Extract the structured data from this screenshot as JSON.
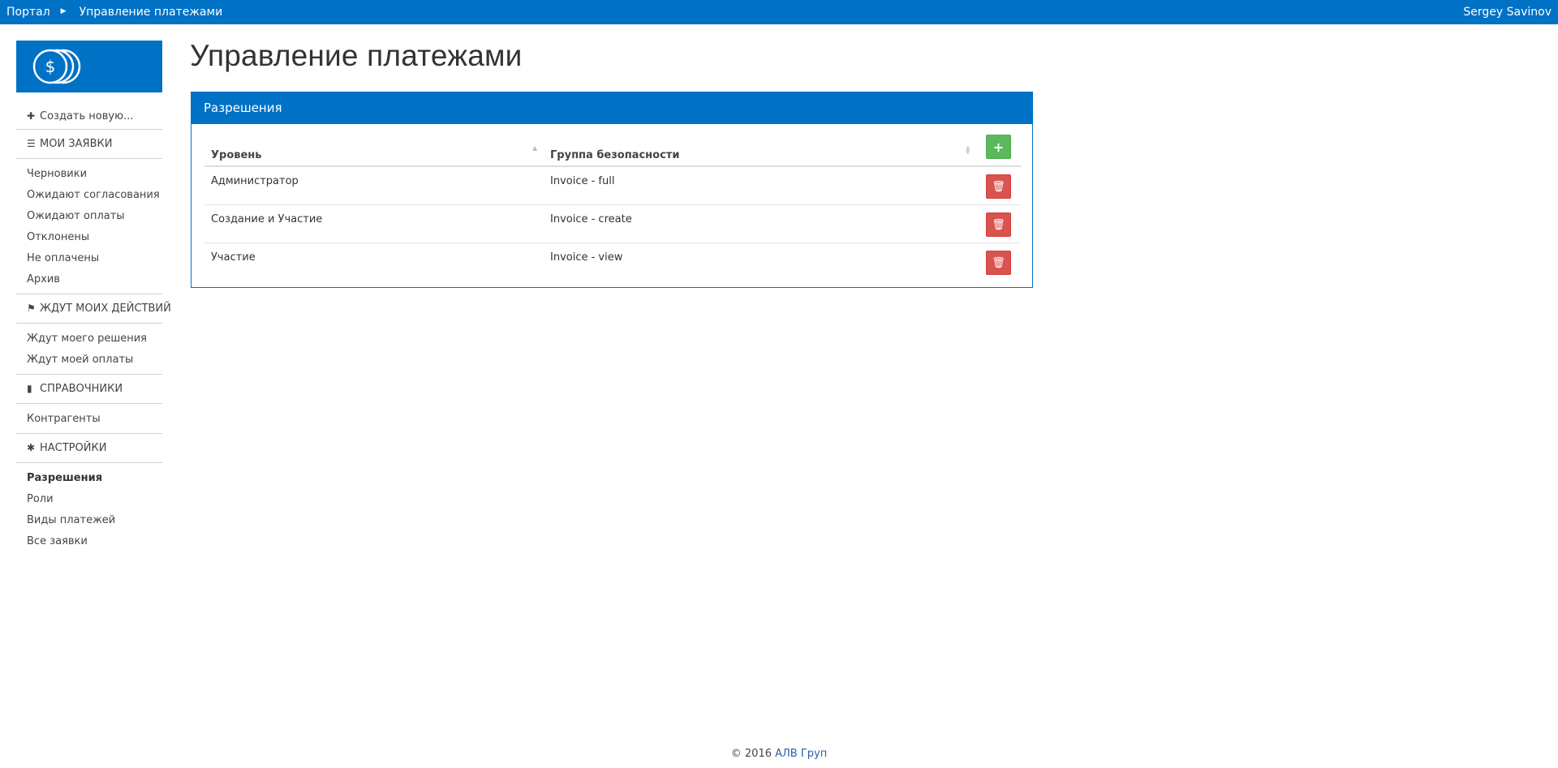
{
  "topbar": {
    "breadcrumb": [
      "Портал",
      "Управление платежами"
    ],
    "user_name": "Sergey Savinov"
  },
  "sidebar": {
    "create_label": "Создать новую...",
    "sections": [
      {
        "title": "МОИ ЗАЯВКИ",
        "icon": "list-icon",
        "items": [
          "Черновики",
          "Ожидают согласования",
          "Ожидают оплаты",
          "Отклонены",
          "Не оплачены",
          "Архив"
        ]
      },
      {
        "title": "ЖДУТ МОИХ ДЕЙСТВИЙ",
        "icon": "flag-icon",
        "items": [
          "Ждут моего решения",
          "Ждут моей оплаты"
        ]
      },
      {
        "title": "СПРАВОЧНИКИ",
        "icon": "book-icon",
        "items": [
          "Контрагенты"
        ]
      },
      {
        "title": "НАСТРОЙКИ",
        "icon": "gear-icon",
        "items": [
          "Разрешения",
          "Роли",
          "Виды платежей",
          "Все заявки"
        ],
        "active_item": "Разрешения"
      }
    ]
  },
  "main": {
    "title": "Управление платежами",
    "panel_title": "Разрешения",
    "table": {
      "columns": [
        "Уровень",
        "Группа безопасности"
      ],
      "rows": [
        [
          "Администратор",
          "Invoice - full"
        ],
        [
          "Создание и Участие",
          "Invoice - create"
        ],
        [
          "Участие",
          "Invoice - view"
        ]
      ]
    }
  },
  "footer": {
    "copyright": "© 2016",
    "company": "АЛВ Груп"
  },
  "colors": {
    "brand": "#0072c6",
    "add": "#5cb85c",
    "delete": "#d9534f"
  }
}
